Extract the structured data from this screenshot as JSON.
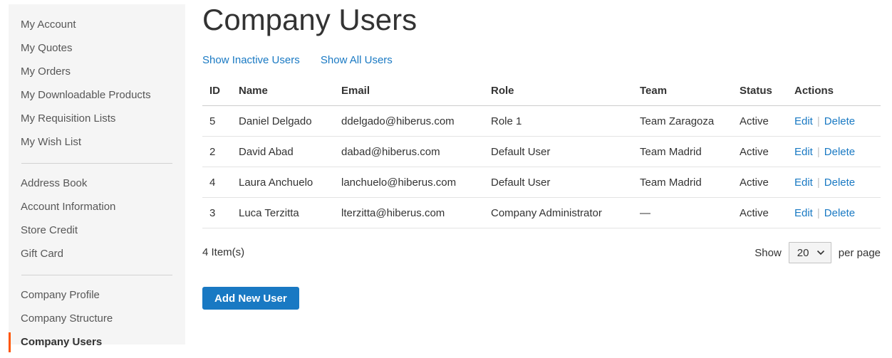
{
  "sidebar": {
    "groups": [
      [
        "My Account",
        "My Quotes",
        "My Orders",
        "My Downloadable Products",
        "My Requisition Lists",
        "My Wish List"
      ],
      [
        "Address Book",
        "Account Information",
        "Store Credit",
        "Gift Card"
      ],
      [
        "Company Profile",
        "Company Structure",
        "Company Users"
      ]
    ],
    "active": "Company Users"
  },
  "main": {
    "title": "Company Users",
    "filters": [
      "Show Inactive Users",
      "Show All Users"
    ],
    "table": {
      "headers": [
        "ID",
        "Name",
        "Email",
        "Role",
        "Team",
        "Status",
        "Actions"
      ],
      "rows": [
        {
          "id": "5",
          "name": "Daniel Delgado",
          "email": "ddelgado@hiberus.com",
          "role": "Role 1",
          "team": "Team Zaragoza",
          "status": "Active"
        },
        {
          "id": "2",
          "name": "David Abad",
          "email": "dabad@hiberus.com",
          "role": "Default User",
          "team": "Team Madrid",
          "status": "Active"
        },
        {
          "id": "4",
          "name": "Laura Anchuelo",
          "email": "lanchuelo@hiberus.com",
          "role": "Default User",
          "team": "Team Madrid",
          "status": "Active"
        },
        {
          "id": "3",
          "name": "Luca Terzitta",
          "email": "lterzitta@hiberus.com",
          "role": "Company Administrator",
          "team": "—",
          "status": "Active"
        }
      ],
      "actions": {
        "edit": "Edit",
        "delete": "Delete",
        "separator": "|"
      }
    },
    "item_count": "4 Item(s)",
    "pager": {
      "show_label": "Show",
      "per_page_value": "20",
      "per_page_label": "per page"
    },
    "add_button": "Add New User"
  },
  "colors": {
    "link": "#1979c3",
    "active_marker": "#ff5501",
    "sidebar_bg": "#f5f5f5"
  }
}
